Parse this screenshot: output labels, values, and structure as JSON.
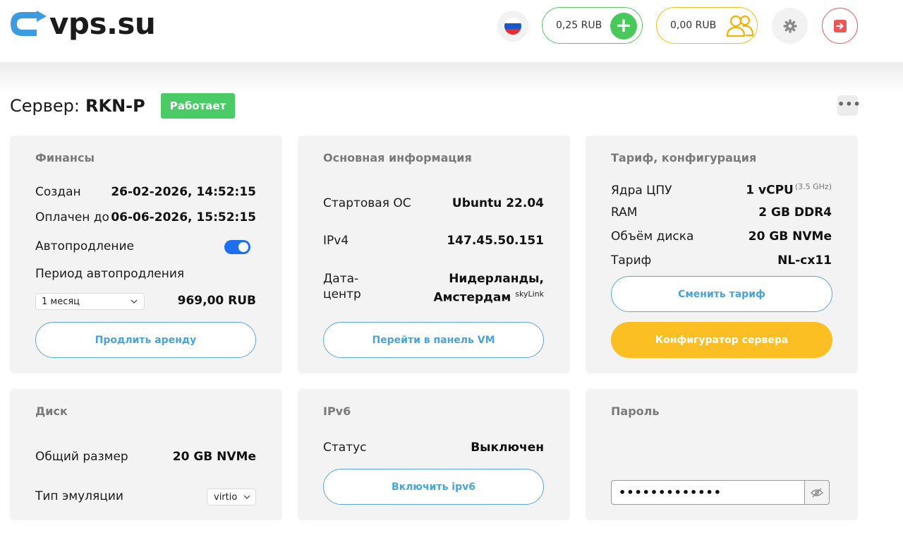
{
  "header": {
    "logo_text": "vps.su",
    "balance": "0,25 RUB",
    "bonus": "0,00 RUB",
    "add_symbol": "+"
  },
  "server": {
    "label": "Сервер:",
    "name": "RKN-P",
    "status": "Работает",
    "more": "•••"
  },
  "finance": {
    "title": "Финансы",
    "created_label": "Создан",
    "created_value": "26-02-2026, 14:52:15",
    "paid_label": "Оплачен до",
    "paid_value": "06-06-2026, 15:52:15",
    "autorenew_label": "Автопродление",
    "autorenew_on": true,
    "period_label": "Период автопродления",
    "period_selected": "1 месяц",
    "price": "969,00 RUB",
    "renew_button": "Продлить аренду"
  },
  "info": {
    "title": "Основная информация",
    "os_label": "Стартовая ОС",
    "os_value": "Ubuntu 22.04",
    "ipv4_label": "IPv4",
    "ipv4_value": "147.45.50.151",
    "dc_label_1": "Дата-",
    "dc_label_2": "центр",
    "dc_value_1": "Нидерланды,",
    "dc_value_2": "Амстердам",
    "dc_provider": "skyLink",
    "panel_button": "Перейти в панель VM"
  },
  "tariff": {
    "title": "Тариф, конфигурация",
    "cpu_label": "Ядра ЦПУ",
    "cpu_value": "1 vCPU",
    "cpu_freq": "(3.5 GHz)",
    "ram_label": "RAM",
    "ram_value": "2 GB DDR4",
    "disk_label": "Объём диска",
    "disk_value": "20 GB NVMe",
    "plan_label": "Тариф",
    "plan_value": "NL-cx11",
    "change_button": "Сменить тариф",
    "config_button": "Конфигуратор сервера"
  },
  "disk": {
    "title": "Диск",
    "size_label": "Общий размер",
    "size_value": "20 GB NVMe",
    "emulation_label": "Тип эмуляции",
    "emulation_value": "virtio"
  },
  "ipv6": {
    "title": "IPv6",
    "status_label": "Статус",
    "status_value": "Выключен",
    "enable_button": "Включить ipv6"
  },
  "password": {
    "title": "Пароль",
    "masked": "•••••••••••••"
  },
  "colors": {
    "status_green": "#4bcb66",
    "accent_blue": "#4aa3d6",
    "accent_yellow": "#fbbf24",
    "logo_blue": "#3d9be0",
    "danger_red": "#ee5555"
  }
}
